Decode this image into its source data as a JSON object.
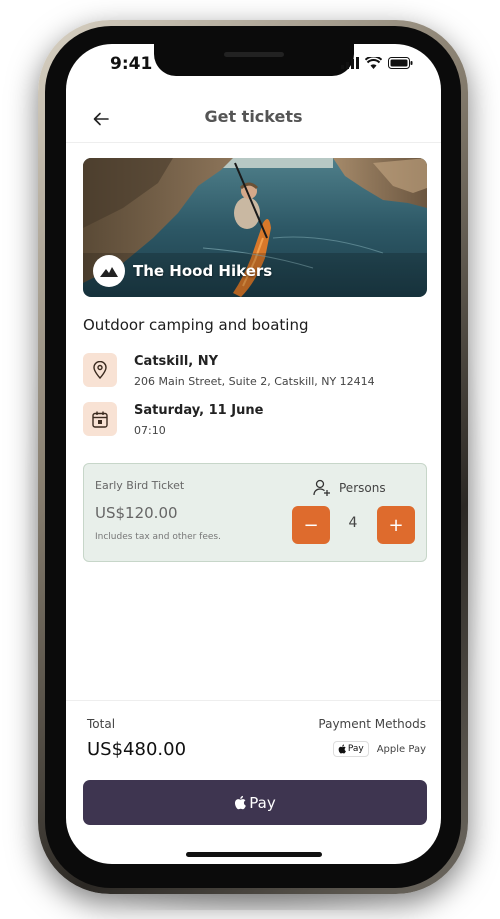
{
  "status_bar": {
    "time": "9:41"
  },
  "header": {
    "title": "Get tickets"
  },
  "hero": {
    "organizer_name": "The Hood Hikers"
  },
  "event": {
    "title": "Outdoor camping and boating",
    "location_name": "Catskill, NY",
    "location_address": "206 Main Street, Suite 2, Catskill, NY 12414",
    "date": "Saturday, 11 June",
    "time": "07:10"
  },
  "ticket": {
    "type": "Early Bird Ticket",
    "price": "US$120.00",
    "note": "Includes tax and other fees.",
    "persons_label": "Persons",
    "quantity": "4",
    "minus_symbol": "−",
    "plus_symbol": "+"
  },
  "footer": {
    "total_label": "Total",
    "total_value": "US$480.00",
    "payment_methods_label": "Payment Methods",
    "apple_pay_badge": "Pay",
    "apple_pay_text": "Apple Pay",
    "pay_button_label": "Pay"
  },
  "colors": {
    "accent": "#de6b2d",
    "icon_bg": "#f8e2d4",
    "ticket_bg": "#e8efea",
    "pay_button": "#3e3550"
  },
  "icons": [
    "back-arrow-icon",
    "location-pin-icon",
    "calendar-icon",
    "add-person-icon",
    "apple-icon"
  ]
}
